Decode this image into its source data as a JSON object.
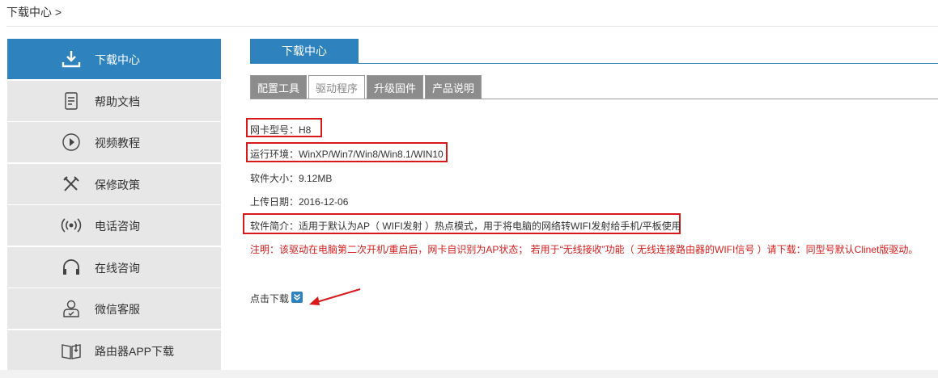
{
  "breadcrumb": "下载中心 >",
  "sidebar": {
    "items": [
      {
        "label": "下载中心",
        "icon": "download-icon"
      },
      {
        "label": "帮助文档",
        "icon": "document-icon"
      },
      {
        "label": "视频教程",
        "icon": "play-icon"
      },
      {
        "label": "保修政策",
        "icon": "tools-icon"
      },
      {
        "label": "电话咨询",
        "icon": "phone-signal-icon"
      },
      {
        "label": "在线咨询",
        "icon": "headset-icon"
      },
      {
        "label": "微信客服",
        "icon": "user-icon"
      },
      {
        "label": "路由器APP下载",
        "icon": "book-icon"
      }
    ]
  },
  "main": {
    "tab_title": "下载中心",
    "subtabs": [
      {
        "label": "配置工具"
      },
      {
        "label": "驱动程序"
      },
      {
        "label": "升级固件"
      },
      {
        "label": "产品说明"
      }
    ],
    "active_subtab": "驱动程序",
    "model": "网卡型号：H8",
    "os": "运行环境：WinXP/Win7/Win8/Win8.1/WIN10",
    "size": "软件大小：9.12MB",
    "date": "上传日期：2016-12-06",
    "intro": "软件简介：适用于默认为AP（ WIFI发射 ）热点模式，用于将电脑的网络转WIFI发射给手机/平板使用",
    "note": "注明：该驱动在电脑第二次开机/重启后，网卡自识别为AP状态； 若用于“无线接收”功能（ 无线连接路由器的WIFI信号 ）请下载：同型号默认Clinet版驱动。",
    "download_label": "点击下载"
  },
  "colors": {
    "accent": "#2e83bf",
    "highlight_box": "#d8191c",
    "note_text": "#d41d1d",
    "sidebar_bg": "#e7e7e7",
    "subtab_bg": "#8c8c8c"
  }
}
